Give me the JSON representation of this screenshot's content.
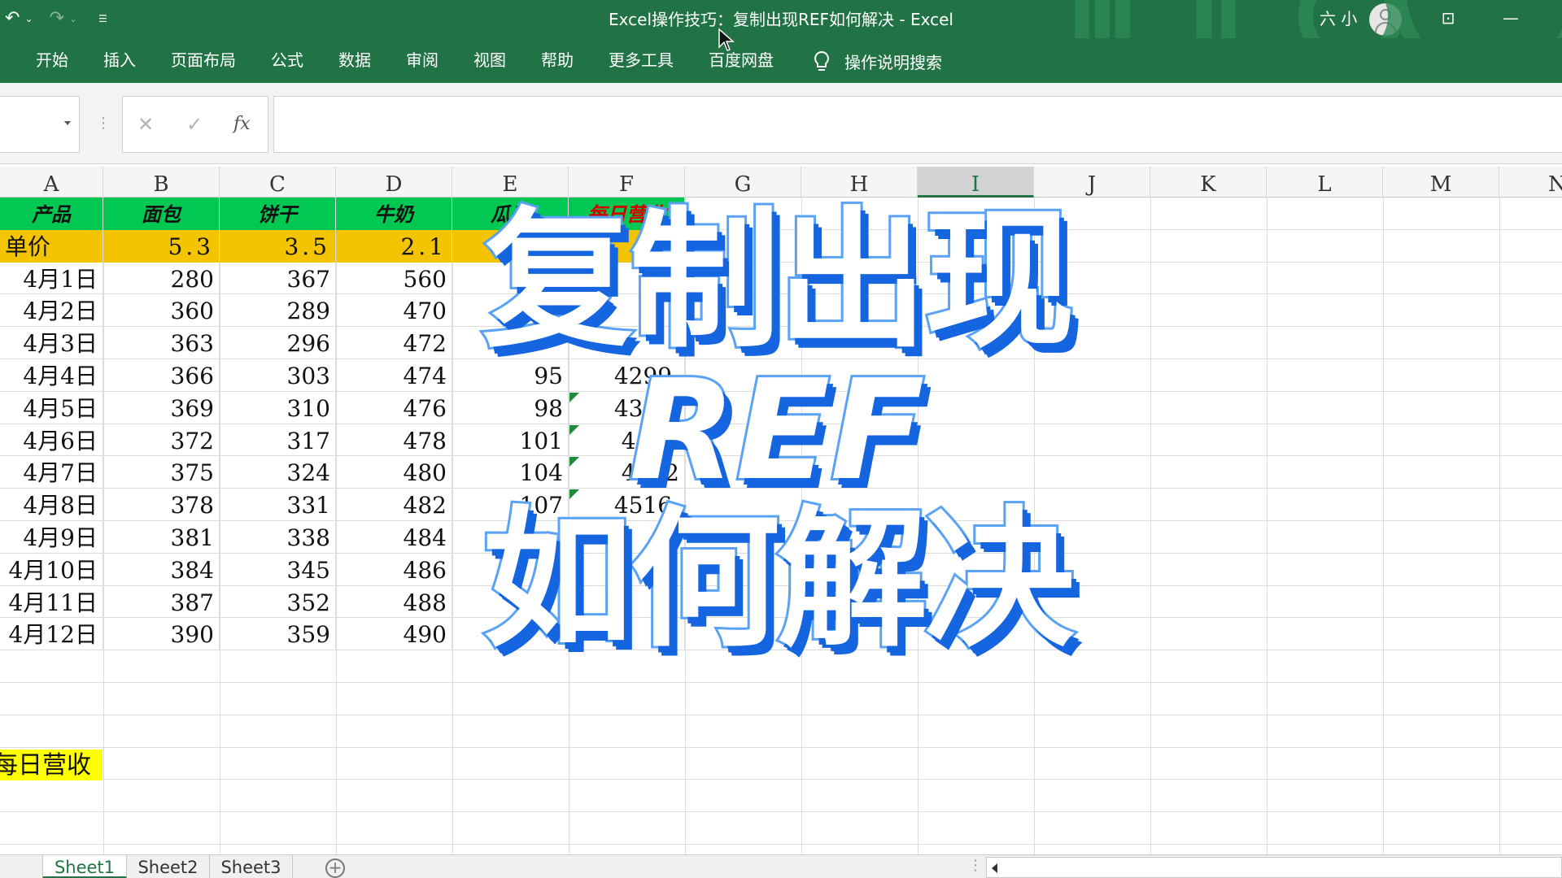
{
  "window": {
    "title": "Excel操作技巧：复制出现REF如何解决  -  Excel",
    "user": "六 小",
    "brand_color": "#217346"
  },
  "qat": {
    "undo_icon": "↶",
    "redo_icon": "↷",
    "customize_icon": "⌄"
  },
  "ribbon": {
    "tabs": [
      "开始",
      "插入",
      "页面布局",
      "公式",
      "数据",
      "审阅",
      "视图",
      "帮助",
      "更多工具",
      "百度网盘"
    ],
    "tellme": "操作说明搜索"
  },
  "formula_bar": {
    "cancel_icon": "✕",
    "enter_icon": "✓",
    "fx_label": "fx",
    "value": ""
  },
  "columns": [
    "A",
    "B",
    "C",
    "D",
    "E",
    "F",
    "G",
    "H",
    "I",
    "J",
    "K",
    "L",
    "M",
    "N"
  ],
  "selected_column": "I",
  "table": {
    "header": [
      "产品",
      "面包",
      "饼干",
      "牛奶",
      "瓜子",
      "每日营收"
    ],
    "price_row": [
      "单价",
      "5.3",
      "3.5",
      "2.1",
      "",
      ""
    ],
    "rows": [
      [
        "4月1日",
        "280",
        "367",
        "560",
        "",
        ""
      ],
      [
        "4月2日",
        "360",
        "289",
        "470",
        "",
        ""
      ],
      [
        "4月3日",
        "363",
        "296",
        "472",
        "",
        ""
      ],
      [
        "4月4日",
        "366",
        "303",
        "474",
        "95",
        "4299."
      ],
      [
        "4月5日",
        "369",
        "310",
        "476",
        "98",
        "4353."
      ],
      [
        "4月6日",
        "372",
        "317",
        "478",
        "101",
        "4408"
      ],
      [
        "4月7日",
        "375",
        "324",
        "480",
        "104",
        "4462"
      ],
      [
        "4月8日",
        "378",
        "331",
        "482",
        "107",
        "4516."
      ],
      [
        "4月9日",
        "381",
        "338",
        "484",
        "",
        ""
      ],
      [
        "4月10日",
        "384",
        "345",
        "486",
        "",
        ""
      ],
      [
        "4月11日",
        "387",
        "352",
        "488",
        "",
        ""
      ],
      [
        "4月12日",
        "390",
        "359",
        "490",
        "",
        ""
      ]
    ],
    "header_color": "#00c853",
    "price_row_color": "#f5c400"
  },
  "extra_cell": {
    "text": "每日营收",
    "color": "#ffff00"
  },
  "overlay": {
    "line1": "复制出现",
    "line2": "REF",
    "line3": "如何解决",
    "fill_color": "#ffffff",
    "stroke_color": "#5aa2f5",
    "shadow_color": "#1565e0"
  },
  "sheets": [
    "Sheet1",
    "Sheet2",
    "Sheet3"
  ],
  "active_sheet": "Sheet1"
}
